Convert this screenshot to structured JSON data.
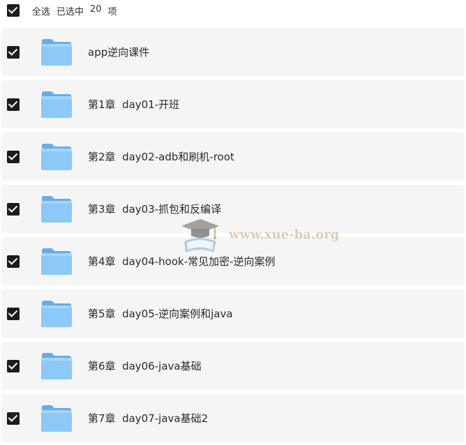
{
  "header": {
    "select_all_label": "全选",
    "selected_prefix": "已选中",
    "selected_count": "20",
    "selected_suffix": "项"
  },
  "folders": [
    {
      "name": "app逆向课件"
    },
    {
      "name": "第1章  day01-开班"
    },
    {
      "name": "第2章  day02-adb和刷机-root"
    },
    {
      "name": "第3章  day03-抓包和反编译"
    },
    {
      "name": "第4章  day04-hook-常见加密-逆向案例"
    },
    {
      "name": "第5章  day05-逆向案例和java"
    },
    {
      "name": "第6章  day06-java基础"
    },
    {
      "name": "第7章  day07-java基础2"
    }
  ],
  "watermark": {
    "text": "www.xue-ba.org"
  },
  "colors": {
    "checkbox": "#1c1c1c",
    "row_background": "#f5f5f6",
    "folder_front": "#8cc8f8",
    "folder_back": "#64acf0"
  },
  "icons": {
    "checkbox": "checkbox-checked-icon",
    "folder": "folder-icon",
    "watermark": "graduation-cap-icon"
  }
}
